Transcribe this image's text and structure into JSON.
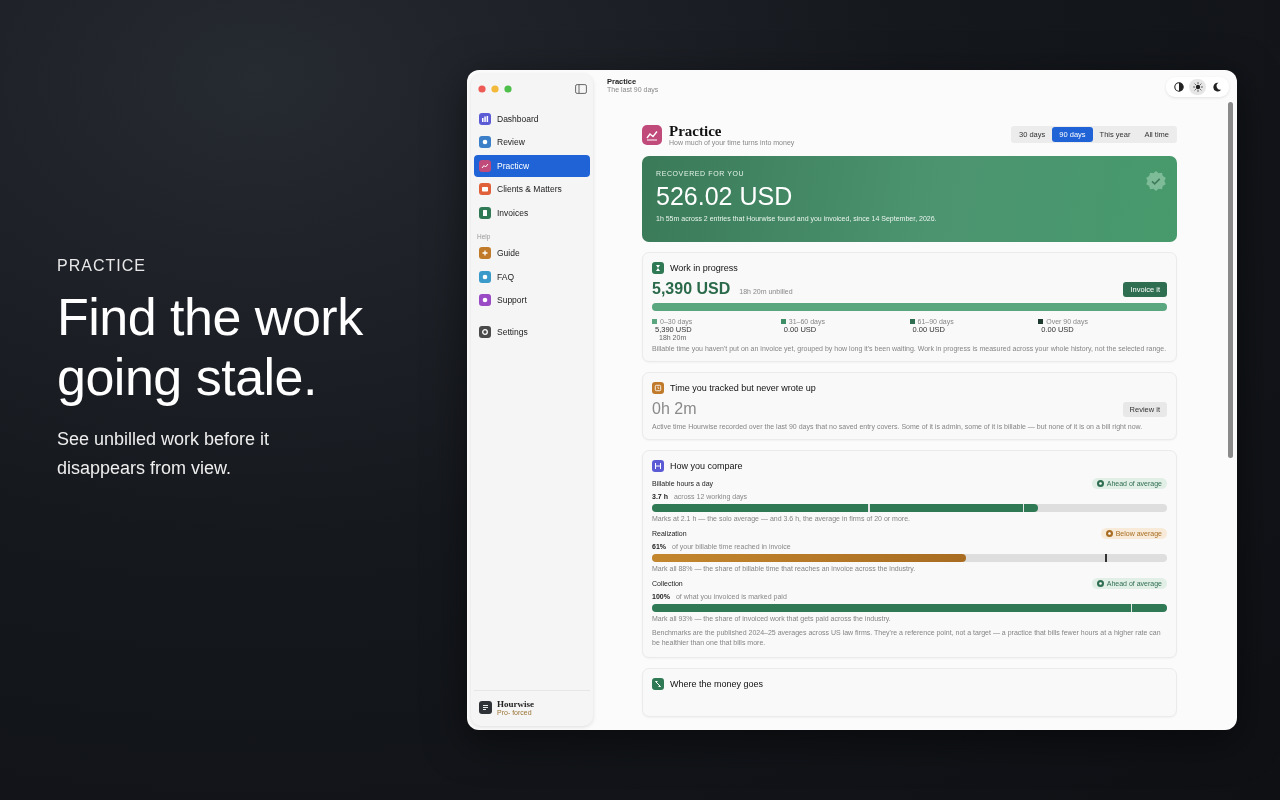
{
  "hero": {
    "eyebrow": "PRACTICE",
    "headline": "Find the work going stale.",
    "subtitle": "See unbilled work before it disappears from view."
  },
  "sidebar": {
    "sections": [
      {
        "items": [
          {
            "label": "Dashboard",
            "color": "#5b5bd6",
            "selected": false
          },
          {
            "label": "Review",
            "color": "#3b7fc8",
            "selected": false
          },
          {
            "label": "Practicw",
            "color": "#c04a7a",
            "selected": true
          },
          {
            "label": "Clients & Matters",
            "color": "#e0603a",
            "selected": false
          },
          {
            "label": "Invoices",
            "color": "#2f7a55",
            "selected": false
          }
        ]
      },
      {
        "heading": "Help",
        "items": [
          {
            "label": "Guide",
            "color": "#c07a2a",
            "selected": false
          },
          {
            "label": "FAQ",
            "color": "#3a9ac9",
            "selected": false
          },
          {
            "label": "Support",
            "color": "#9b4ac6",
            "selected": false
          }
        ]
      },
      {
        "items": [
          {
            "label": "Settings",
            "color": "#4a4a4a",
            "selected": false
          }
        ]
      }
    ],
    "footer": {
      "name": "Hourwise",
      "plan": "Pro- forced"
    }
  },
  "topbar": {
    "title": "Practice",
    "subtitle": "The last 90 days"
  },
  "theme_toggle": [
    {
      "kind": "contrast",
      "selected": false
    },
    {
      "kind": "light",
      "selected": true
    },
    {
      "kind": "dark",
      "selected": false
    }
  ],
  "page_header": {
    "title": "Practice",
    "subtitle": "How much of your time turns into money"
  },
  "ranges": [
    {
      "label": "30 days",
      "selected": false
    },
    {
      "label": "90 days",
      "selected": true
    },
    {
      "label": "This year",
      "selected": false
    },
    {
      "label": "All time",
      "selected": false
    }
  ],
  "recovered": {
    "eyebrow": "RECOVERED FOR YOU",
    "amount": "526.02 USD",
    "note": "1h 55m across 2 entries that Hourwise found and you invoiced, since 14 September, 2026."
  },
  "wip": {
    "title": "Work in progress",
    "amount": "5,390 USD",
    "hours": "18h 20m unbilled",
    "button": "Invoice it",
    "level": 1,
    "buckets": [
      {
        "label": "0–30 days",
        "amount": "5,390 USD",
        "hours": "18h 20m",
        "color": "#5aa77f"
      },
      {
        "label": "31–60 days",
        "amount": "0.00 USD",
        "color": "#3f8f66"
      },
      {
        "label": "61–90 days",
        "amount": "0.00 USD",
        "color": "#2f6e50"
      },
      {
        "label": "Over 90 days",
        "amount": "0.00 USD",
        "color": "#1f3a2e"
      }
    ],
    "note": "Billable time you haven't put on an invoice yet, grouped by how long it's been waiting. Work in progress is measured across your whole history, not the selected range."
  },
  "untracked": {
    "title": "Time you tracked but never wrote up",
    "amount": "0h 2m",
    "button": "Review it",
    "note": "Active time Hourwise recorded over the last 90 days that no saved entry covers. Some of it is admin, some of it is billable — but none of it is on a bill right now."
  },
  "compare": {
    "title": "How you compare",
    "metrics": [
      {
        "label": "Billable hours a day",
        "value": "3.7 h",
        "caption": "across 12 working days",
        "kind": "ahead",
        "status": "Ahead of average",
        "level": 0.75,
        "marks": [
          {
            "level": 0.42
          },
          {
            "level": 0.72
          }
        ],
        "note": "Marks at 2.1 h — the solo average — and 3.6 h, the average in firms of 20 or more."
      },
      {
        "label": "Realization",
        "value": "61%",
        "caption": "of your billable time reached in invoice",
        "kind": "below",
        "status": "Below average",
        "level": 0.61,
        "marks": [
          {
            "level": 0.88
          }
        ],
        "note": "Mark all 88% — the share of billable time that reaches an invoice across the industry."
      },
      {
        "label": "Collection",
        "value": "100%",
        "caption": "of what you invoiced is marked paid",
        "kind": "ahead",
        "status": "Ahead of average",
        "level": 1,
        "marks": [
          {
            "level": 0.93
          }
        ],
        "note": "Mark all 93% — the share of invoiced work that gets paid across the industry."
      }
    ],
    "footer": "Benchmarks are the published 2024–25 averages across US law firms. They're a reference point, not a target — a practice that bills fewer hours at a higher rate can be healthier than one that bills more."
  },
  "money": {
    "title": "Where the money goes"
  }
}
